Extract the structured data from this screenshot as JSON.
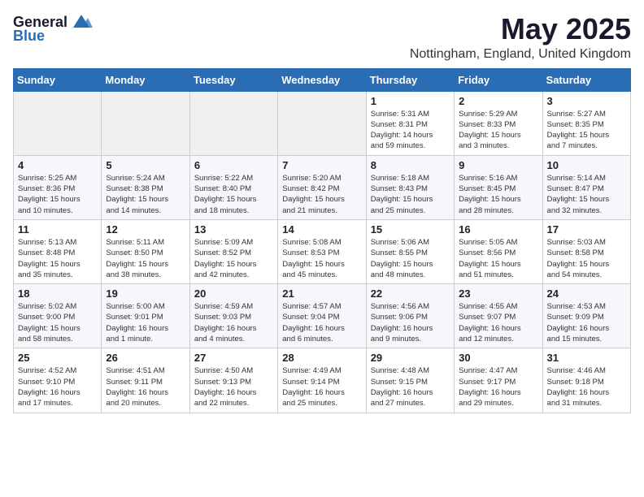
{
  "header": {
    "logo_general": "General",
    "logo_blue": "Blue",
    "title": "May 2025",
    "subtitle": "Nottingham, England, United Kingdom"
  },
  "weekdays": [
    "Sunday",
    "Monday",
    "Tuesday",
    "Wednesday",
    "Thursday",
    "Friday",
    "Saturday"
  ],
  "weeks": [
    [
      {
        "day": "",
        "info": ""
      },
      {
        "day": "",
        "info": ""
      },
      {
        "day": "",
        "info": ""
      },
      {
        "day": "",
        "info": ""
      },
      {
        "day": "1",
        "info": "Sunrise: 5:31 AM\nSunset: 8:31 PM\nDaylight: 14 hours\nand 59 minutes."
      },
      {
        "day": "2",
        "info": "Sunrise: 5:29 AM\nSunset: 8:33 PM\nDaylight: 15 hours\nand 3 minutes."
      },
      {
        "day": "3",
        "info": "Sunrise: 5:27 AM\nSunset: 8:35 PM\nDaylight: 15 hours\nand 7 minutes."
      }
    ],
    [
      {
        "day": "4",
        "info": "Sunrise: 5:25 AM\nSunset: 8:36 PM\nDaylight: 15 hours\nand 10 minutes."
      },
      {
        "day": "5",
        "info": "Sunrise: 5:24 AM\nSunset: 8:38 PM\nDaylight: 15 hours\nand 14 minutes."
      },
      {
        "day": "6",
        "info": "Sunrise: 5:22 AM\nSunset: 8:40 PM\nDaylight: 15 hours\nand 18 minutes."
      },
      {
        "day": "7",
        "info": "Sunrise: 5:20 AM\nSunset: 8:42 PM\nDaylight: 15 hours\nand 21 minutes."
      },
      {
        "day": "8",
        "info": "Sunrise: 5:18 AM\nSunset: 8:43 PM\nDaylight: 15 hours\nand 25 minutes."
      },
      {
        "day": "9",
        "info": "Sunrise: 5:16 AM\nSunset: 8:45 PM\nDaylight: 15 hours\nand 28 minutes."
      },
      {
        "day": "10",
        "info": "Sunrise: 5:14 AM\nSunset: 8:47 PM\nDaylight: 15 hours\nand 32 minutes."
      }
    ],
    [
      {
        "day": "11",
        "info": "Sunrise: 5:13 AM\nSunset: 8:48 PM\nDaylight: 15 hours\nand 35 minutes."
      },
      {
        "day": "12",
        "info": "Sunrise: 5:11 AM\nSunset: 8:50 PM\nDaylight: 15 hours\nand 38 minutes."
      },
      {
        "day": "13",
        "info": "Sunrise: 5:09 AM\nSunset: 8:52 PM\nDaylight: 15 hours\nand 42 minutes."
      },
      {
        "day": "14",
        "info": "Sunrise: 5:08 AM\nSunset: 8:53 PM\nDaylight: 15 hours\nand 45 minutes."
      },
      {
        "day": "15",
        "info": "Sunrise: 5:06 AM\nSunset: 8:55 PM\nDaylight: 15 hours\nand 48 minutes."
      },
      {
        "day": "16",
        "info": "Sunrise: 5:05 AM\nSunset: 8:56 PM\nDaylight: 15 hours\nand 51 minutes."
      },
      {
        "day": "17",
        "info": "Sunrise: 5:03 AM\nSunset: 8:58 PM\nDaylight: 15 hours\nand 54 minutes."
      }
    ],
    [
      {
        "day": "18",
        "info": "Sunrise: 5:02 AM\nSunset: 9:00 PM\nDaylight: 15 hours\nand 58 minutes."
      },
      {
        "day": "19",
        "info": "Sunrise: 5:00 AM\nSunset: 9:01 PM\nDaylight: 16 hours\nand 1 minute."
      },
      {
        "day": "20",
        "info": "Sunrise: 4:59 AM\nSunset: 9:03 PM\nDaylight: 16 hours\nand 4 minutes."
      },
      {
        "day": "21",
        "info": "Sunrise: 4:57 AM\nSunset: 9:04 PM\nDaylight: 16 hours\nand 6 minutes."
      },
      {
        "day": "22",
        "info": "Sunrise: 4:56 AM\nSunset: 9:06 PM\nDaylight: 16 hours\nand 9 minutes."
      },
      {
        "day": "23",
        "info": "Sunrise: 4:55 AM\nSunset: 9:07 PM\nDaylight: 16 hours\nand 12 minutes."
      },
      {
        "day": "24",
        "info": "Sunrise: 4:53 AM\nSunset: 9:09 PM\nDaylight: 16 hours\nand 15 minutes."
      }
    ],
    [
      {
        "day": "25",
        "info": "Sunrise: 4:52 AM\nSunset: 9:10 PM\nDaylight: 16 hours\nand 17 minutes."
      },
      {
        "day": "26",
        "info": "Sunrise: 4:51 AM\nSunset: 9:11 PM\nDaylight: 16 hours\nand 20 minutes."
      },
      {
        "day": "27",
        "info": "Sunrise: 4:50 AM\nSunset: 9:13 PM\nDaylight: 16 hours\nand 22 minutes."
      },
      {
        "day": "28",
        "info": "Sunrise: 4:49 AM\nSunset: 9:14 PM\nDaylight: 16 hours\nand 25 minutes."
      },
      {
        "day": "29",
        "info": "Sunrise: 4:48 AM\nSunset: 9:15 PM\nDaylight: 16 hours\nand 27 minutes."
      },
      {
        "day": "30",
        "info": "Sunrise: 4:47 AM\nSunset: 9:17 PM\nDaylight: 16 hours\nand 29 minutes."
      },
      {
        "day": "31",
        "info": "Sunrise: 4:46 AM\nSunset: 9:18 PM\nDaylight: 16 hours\nand 31 minutes."
      }
    ]
  ]
}
